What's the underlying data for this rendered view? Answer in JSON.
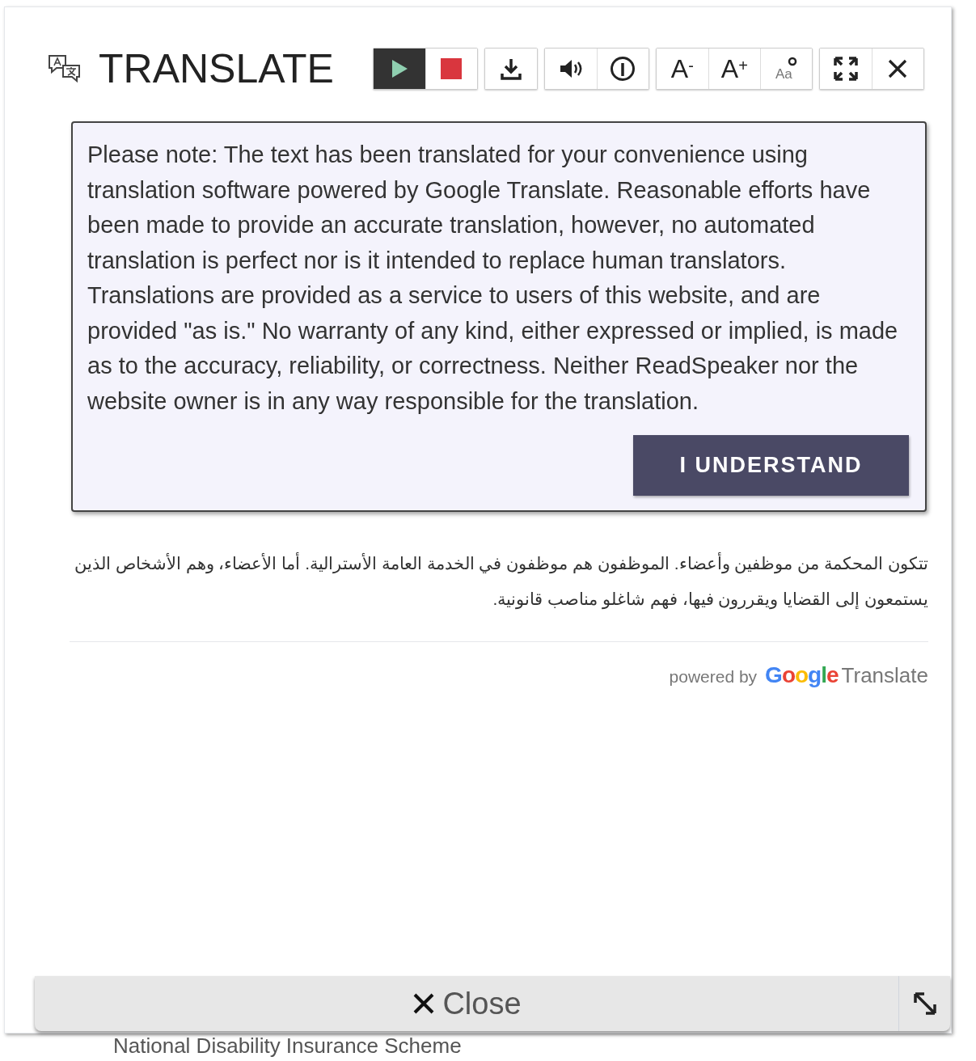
{
  "header": {
    "title": "TRANSLATE"
  },
  "toolbar": [
    {
      "buttons": [
        {
          "kind": "play",
          "selected": true
        },
        {
          "kind": "stop",
          "selected": false
        }
      ]
    },
    {
      "buttons": [
        {
          "kind": "download",
          "selected": false
        }
      ]
    },
    {
      "buttons": [
        {
          "kind": "volume",
          "selected": false
        },
        {
          "kind": "info",
          "selected": false
        }
      ]
    },
    {
      "buttons": [
        {
          "kind": "text",
          "label": "A",
          "sup": "-",
          "selected": false
        },
        {
          "kind": "text",
          "label": "A",
          "sup": "+",
          "selected": false
        },
        {
          "kind": "text-settings",
          "label": "Aa",
          "selected": false
        }
      ]
    },
    {
      "buttons": [
        {
          "kind": "fullscreen",
          "selected": false
        },
        {
          "kind": "close",
          "selected": false
        }
      ]
    }
  ],
  "notice": {
    "text": "Please note: The text has been translated for your convenience using translation software powered by Google Translate. Reasonable efforts have been made to provide an accurate translation, however, no automated translation is perfect nor is it intended to replace human translators. Translations are provided as a service to users of this website, and are provided \"as is.\" No warranty of any kind, either expressed or implied, is made as to the accuracy, reliability, or correctness. Neither ReadSpeaker nor the website owner is in any way responsible for the translation.",
    "button": "I UNDERSTAND"
  },
  "translation": "تتكون المحكمة من موظفين وأعضاء. الموظفون هم موظفون في الخدمة العامة الأسترالية. أما الأعضاء، وهم الأشخاص الذين يستمعون إلى القضايا ويقررون فيها، فهم شاغلو مناصب قانونية.",
  "attribution": {
    "prefix": "powered by",
    "brand": "Google",
    "product": "Translate"
  },
  "close_bar": {
    "label": "Close"
  },
  "background_text": "National Disability Insurance Scheme"
}
